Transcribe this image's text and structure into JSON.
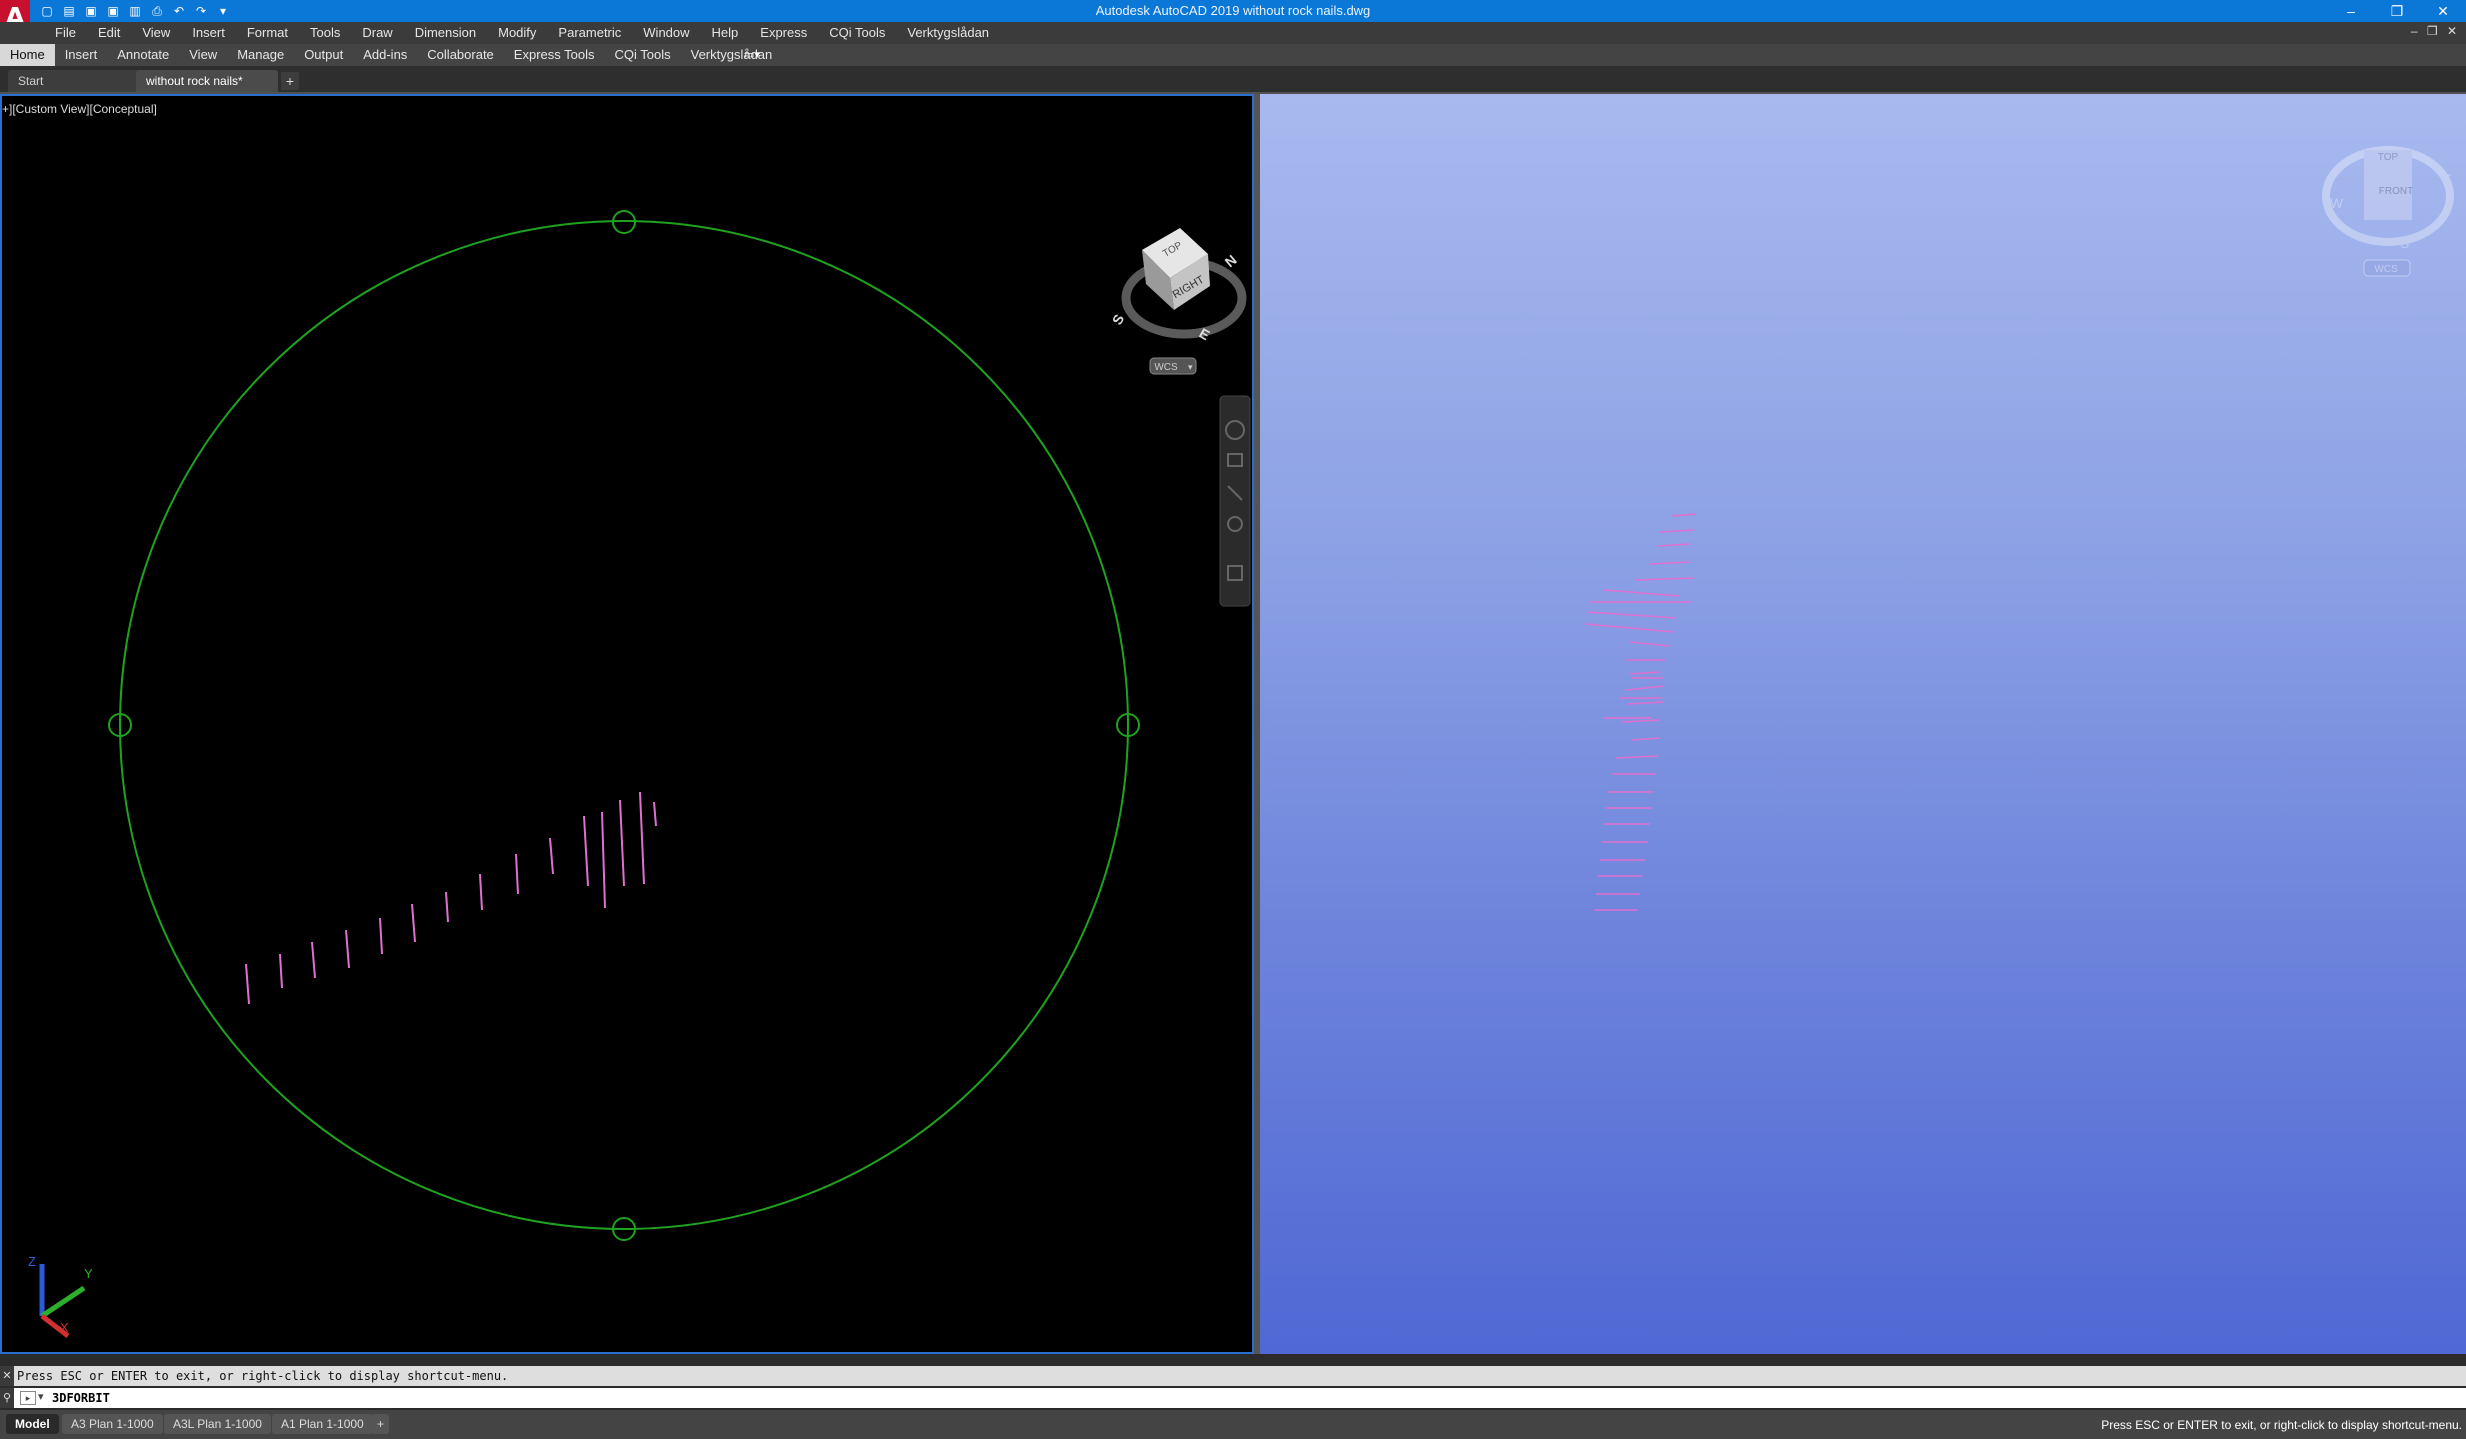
{
  "window": {
    "title": "Autodesk AutoCAD 2019    without rock nails.dwg",
    "logo": "A",
    "min": "–",
    "restore": "❐",
    "close": "✕"
  },
  "menubar": {
    "items": [
      "File",
      "Edit",
      "View",
      "Insert",
      "Format",
      "Tools",
      "Draw",
      "Dimension",
      "Modify",
      "Parametric",
      "Window",
      "Help",
      "Express",
      "CQi Tools",
      "Verktygslådan"
    ]
  },
  "ribbon": {
    "tabs": [
      "Home",
      "Insert",
      "Annotate",
      "View",
      "Manage",
      "Output",
      "Add-ins",
      "Collaborate",
      "Express Tools",
      "CQi Tools",
      "Verktygslådan"
    ],
    "active": "Home"
  },
  "filetabs": {
    "tabs": [
      {
        "label": "Start"
      },
      {
        "label": "without rock nails*",
        "close": "✕"
      }
    ],
    "add": "+"
  },
  "viewport_left": {
    "label": "+][Custom View][Conceptual]",
    "viewcube": {
      "face": "RIGHT",
      "top_face": "TOP",
      "compass": [
        "N",
        "S",
        "E"
      ],
      "ucs": "WCS"
    },
    "axes": {
      "x": "X",
      "y": "Y",
      "z": "Z"
    }
  },
  "viewport_right": {
    "viewcube": {
      "top_face": "TOP",
      "front_face": "FRONT",
      "compass": [
        "W",
        "E",
        "S"
      ],
      "ucs": "WCS"
    }
  },
  "command": {
    "history": "Press ESC or ENTER to exit, or right-click to display shortcut-menu.",
    "current": "3DFORBIT"
  },
  "layouts": {
    "tabs": [
      "Model",
      "A3 Plan 1-1000",
      "A3L Plan 1-1000",
      "A1 Plan 1-1000"
    ],
    "active": "Model",
    "add": "+"
  },
  "status": {
    "message": "Press ESC or ENTER to exit, or right-click to display shortcut-menu."
  },
  "colors": {
    "title_bar": "#0b78d8",
    "orbit_circle": "#1fa21f",
    "nails": "#e070d0",
    "viewport_border": "#2a6fcf"
  }
}
